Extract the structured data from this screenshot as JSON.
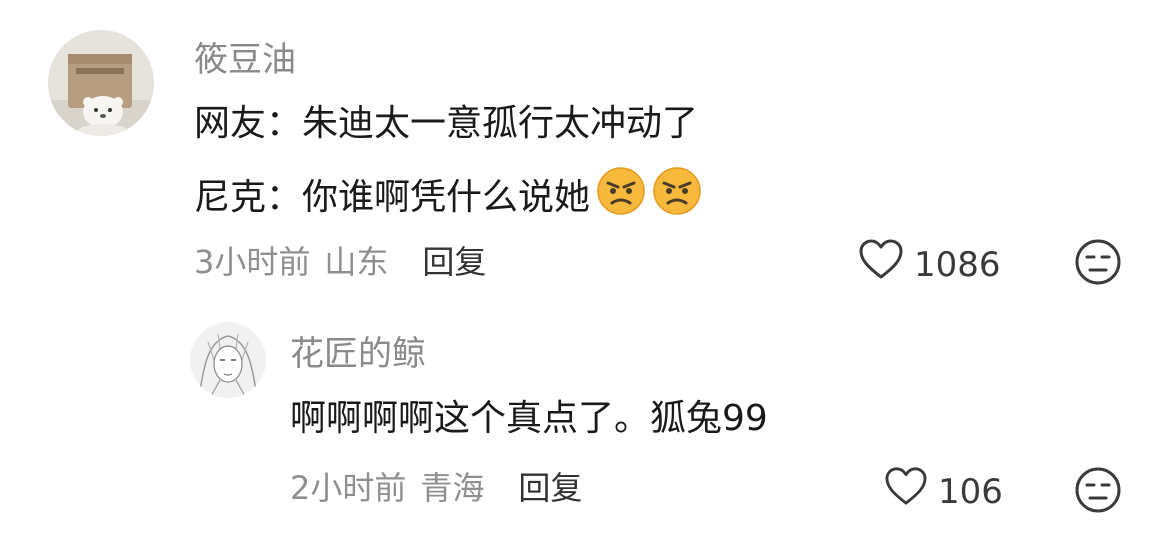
{
  "comments": [
    {
      "username": "筱豆油",
      "lines": [
        {
          "text": "网友：朱迪太一意孤行太冲动了"
        },
        {
          "text": "尼克：你谁啊凭什么说她",
          "emojis": [
            "angry-face-icon",
            "angry-face-icon"
          ]
        }
      ],
      "time": "3小时前",
      "location": "山东",
      "reply_label": "回复",
      "like_count": "1086"
    },
    {
      "username": "花匠的鲸",
      "lines": [
        {
          "text": "啊啊啊啊这个真点了。狐兔99"
        }
      ],
      "time": "2小时前",
      "location": "青海",
      "reply_label": "回复",
      "like_count": "106"
    }
  ],
  "colors": {
    "username": "#8a8a8a",
    "meta": "#8f8f8f",
    "emoji_face": "#f6b93b"
  }
}
